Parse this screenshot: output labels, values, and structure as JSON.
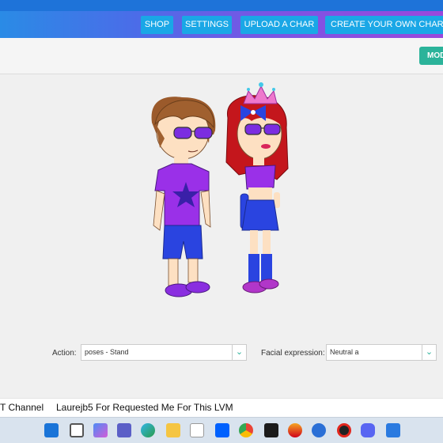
{
  "nav": {
    "shop": "SHOP",
    "settings": "SETTINGS",
    "upload": "UPLOAD A CHAR",
    "create": "CREATE YOUR OWN CHARACTER"
  },
  "toolbar": {
    "mode_label": "MODE"
  },
  "controls": {
    "action_label": "Action:",
    "action_value": "poses - Stand",
    "facial_label": "Facial expression:",
    "facial_value": "Neutral a"
  },
  "ticker": {
    "part1": "T Channel",
    "part2": "Laurejb5 For Requested Me For This LVM"
  },
  "colors": {
    "accent": "#2bb39a",
    "nav_button": "#1aa7e6",
    "titlebar": "#1e73d9"
  },
  "taskbar": {
    "icons": [
      "windows-start-icon",
      "search-icon",
      "task-view-icon",
      "copilot-icon",
      "teams-icon",
      "edge-icon",
      "file-explorer-icon",
      "store-icon",
      "dropbox-icon",
      "chrome-icon",
      "vegas-icon",
      "media-icon",
      "sourcetree-icon",
      "record-icon",
      "discord-icon",
      "share-icon"
    ]
  }
}
